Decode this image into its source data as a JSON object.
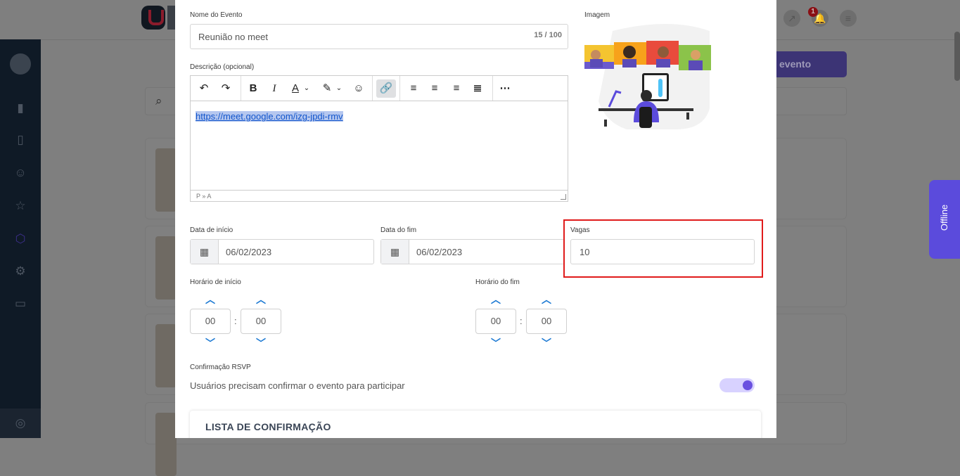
{
  "background": {
    "new_event_label": "evento",
    "notification_count": "1",
    "offline_label": "Offline"
  },
  "form": {
    "event_name": {
      "label": "Nome do Evento",
      "value": "Reunião no meet",
      "counter": "15 / 100"
    },
    "description": {
      "label": "Descrição (opcional)",
      "link_text": "https://meet.google.com/izg-jpdi-rmv",
      "status_path": "P » A"
    },
    "image": {
      "label": "Imagem"
    },
    "start_date": {
      "label": "Data de início",
      "value": "06/02/2023"
    },
    "end_date": {
      "label": "Data do fim",
      "value": "06/02/2023"
    },
    "vacancies": {
      "label": "Vagas",
      "value": "10"
    },
    "start_time": {
      "label": "Horário de início",
      "hours": "00",
      "minutes": "00"
    },
    "end_time": {
      "label": "Horário do fim",
      "hours": "00",
      "minutes": "00"
    },
    "rsvp": {
      "label": "Confirmação RSVP",
      "description": "Usuários precisam confirmar o evento para participar",
      "enabled": true
    },
    "confirmation_list": {
      "title": "LISTA DE CONFIRMAÇÃO"
    }
  },
  "colors": {
    "accent": "#6a51e0",
    "spinner_arrow": "#1877d2",
    "highlight_border": "#e01b1b",
    "sidebar": "#0f1a26"
  }
}
